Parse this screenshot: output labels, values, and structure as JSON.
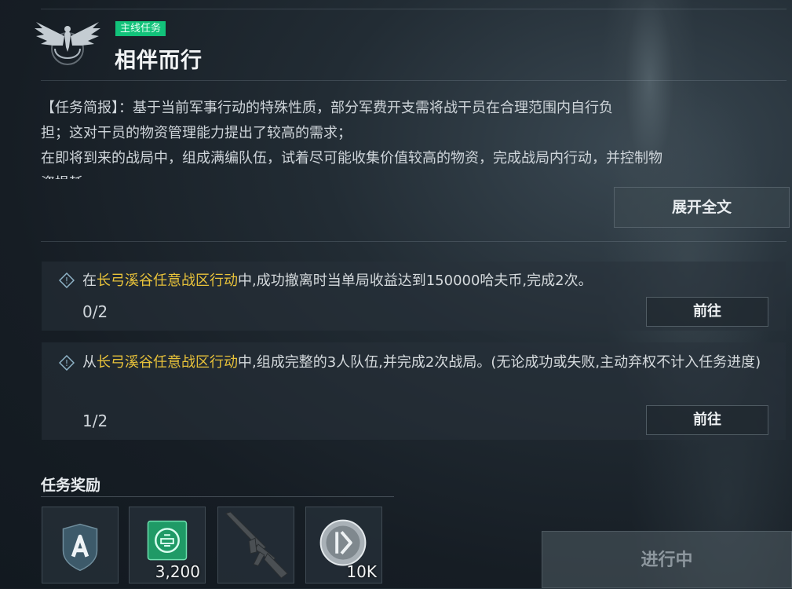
{
  "mission": {
    "tag": "主线任务",
    "title": "相伴而行",
    "description": [
      "【任务简报】：基于当前军事行动的特殊性质，部分军费开支需将战干员在合理范围内自行负",
      "担；这对干员的物资管理能力提出了较高的需求；",
      "在即将到来的战局中，组成满编队伍，试着尽可能收集价值较高的物资，完成战局内行动，并控制物",
      "资损耗"
    ],
    "expand_label": "展开全文"
  },
  "objectives": [
    {
      "prefix": "在",
      "highlight": "长弓溪谷任意战区行动",
      "suffix": "中,成功撤离时当单局收益达到150000哈夫币,完成2次。",
      "progress": "0/2",
      "button": "前往"
    },
    {
      "prefix": "从",
      "highlight": "长弓溪谷任意战区行动",
      "suffix": "中,组成完整的3人队伍,并完成2次战局。(无论成功或失败,主动弃权不计入任务进度)",
      "progress": "1/2",
      "button": "前往"
    }
  ],
  "rewards": {
    "title": "任务奖励",
    "items": [
      {
        "icon": "shield-badge-icon",
        "count": ""
      },
      {
        "icon": "green-supply-crate-icon",
        "count": "3,200"
      },
      {
        "icon": "assault-rifle-icon",
        "count": ""
      },
      {
        "icon": "silver-coin-icon",
        "count": "10K"
      }
    ]
  },
  "status_label": "进行中",
  "colors": {
    "tag": "#12c27a",
    "highlight": "#e8c23a",
    "background": "#1a222a"
  }
}
